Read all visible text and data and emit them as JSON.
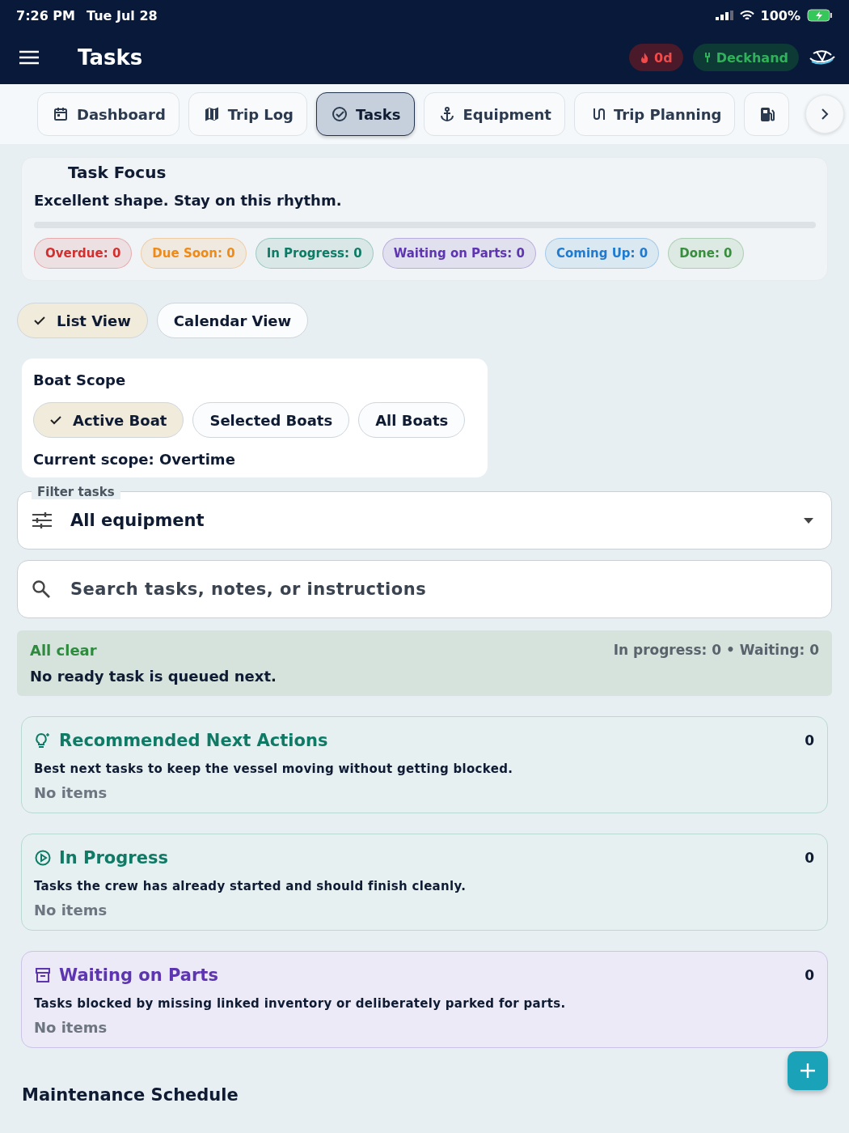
{
  "status_bar": {
    "time": "7:26 PM",
    "date": "Tue Jul 28",
    "battery": "100%"
  },
  "header": {
    "title": "Tasks",
    "streak": "0d",
    "role": "Deckhand"
  },
  "tabs": [
    {
      "kind": "calendar",
      "label": "Dashboard",
      "selected": false
    },
    {
      "kind": "map",
      "label": "Trip Log",
      "selected": false
    },
    {
      "kind": "check",
      "label": "Tasks",
      "selected": true
    },
    {
      "kind": "anchor",
      "label": "Equipment",
      "selected": false
    },
    {
      "kind": "route",
      "label": "Trip Planning",
      "selected": false
    },
    {
      "kind": "fuel",
      "selected": false
    }
  ],
  "focus": {
    "title": "Task Focus",
    "message": "Excellent shape. Stay on this rhythm.",
    "counts": [
      {
        "label": "Overdue: 0",
        "color": "#d32f2f"
      },
      {
        "label": "Due Soon: 0",
        "color": "#ef8a17"
      },
      {
        "label": "In Progress: 0",
        "color": "#0f7b66"
      },
      {
        "label": "Waiting on Parts: 0",
        "color": "#5e35b1"
      },
      {
        "label": "Coming Up: 0",
        "color": "#1e7bd0"
      },
      {
        "label": "Done: 0",
        "color": "#388e3c"
      }
    ]
  },
  "views": [
    {
      "label": "List View",
      "selected": true
    },
    {
      "label": "Calendar View",
      "selected": false
    }
  ],
  "boat_scope": {
    "title": "Boat Scope",
    "options": [
      {
        "label": "Active Boat",
        "selected": true
      },
      {
        "label": "Selected Boats",
        "selected": false
      },
      {
        "label": "All Boats",
        "selected": false
      }
    ],
    "current": "Current scope: Overtime"
  },
  "filter": {
    "label": "Filter tasks",
    "value": "All equipment"
  },
  "search": {
    "placeholder": "Search tasks, notes, or instructions"
  },
  "banner": {
    "title": "All clear",
    "counts": "In progress: 0 • Waiting: 0",
    "message": "No ready task is queued next."
  },
  "sections": [
    {
      "kind": "recommended",
      "title": "Recommended Next Actions",
      "count": "0",
      "description": "Best next tasks to keep the vessel moving without getting blocked.",
      "empty": "No items"
    },
    {
      "kind": "progress",
      "title": "In Progress",
      "count": "0",
      "description": "Tasks the crew has already started and should finish cleanly.",
      "empty": "No items"
    },
    {
      "kind": "parts",
      "title": "Waiting on Parts",
      "count": "0",
      "description": "Tasks blocked by missing linked inventory or deliberately parked for parts.",
      "empty": "No items"
    }
  ],
  "schedule_title": "Maintenance Schedule"
}
